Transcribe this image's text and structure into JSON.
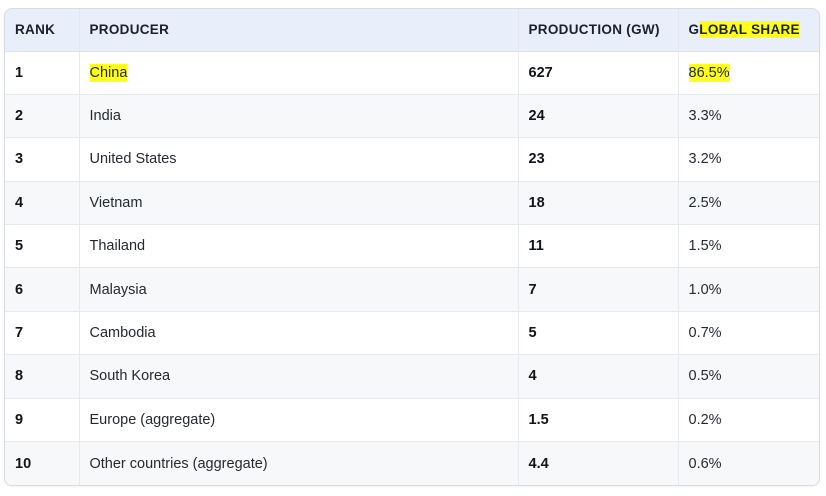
{
  "table": {
    "headers": {
      "rank": "RANK",
      "producer": "PRODUCER",
      "production": "PRODUCTION (GW)",
      "share": "GLOBAL SHARE"
    },
    "rows": [
      {
        "rank": "1",
        "producer": "China",
        "production": "627",
        "share": "86.5%"
      },
      {
        "rank": "2",
        "producer": "India",
        "production": "24",
        "share": "3.3%"
      },
      {
        "rank": "3",
        "producer": "United States",
        "production": "23",
        "share": "3.2%"
      },
      {
        "rank": "4",
        "producer": "Vietnam",
        "production": "18",
        "share": "2.5%"
      },
      {
        "rank": "5",
        "producer": "Thailand",
        "production": "11",
        "share": "1.5%"
      },
      {
        "rank": "6",
        "producer": "Malaysia",
        "production": "7",
        "share": "1.0%"
      },
      {
        "rank": "7",
        "producer": "Cambodia",
        "production": "5",
        "share": "0.7%"
      },
      {
        "rank": "8",
        "producer": "South Korea",
        "production": "4",
        "share": "0.5%"
      },
      {
        "rank": "9",
        "producer": "Europe (aggregate)",
        "production": "1.5",
        "share": "0.2%"
      },
      {
        "rank": "10",
        "producer": "Other countries (aggregate)",
        "production": "4.4",
        "share": "0.6%"
      }
    ]
  },
  "colors": {
    "header_bg": "#e9eefb",
    "highlight": "#ffff1a",
    "stripe": "#f7f8fa"
  }
}
